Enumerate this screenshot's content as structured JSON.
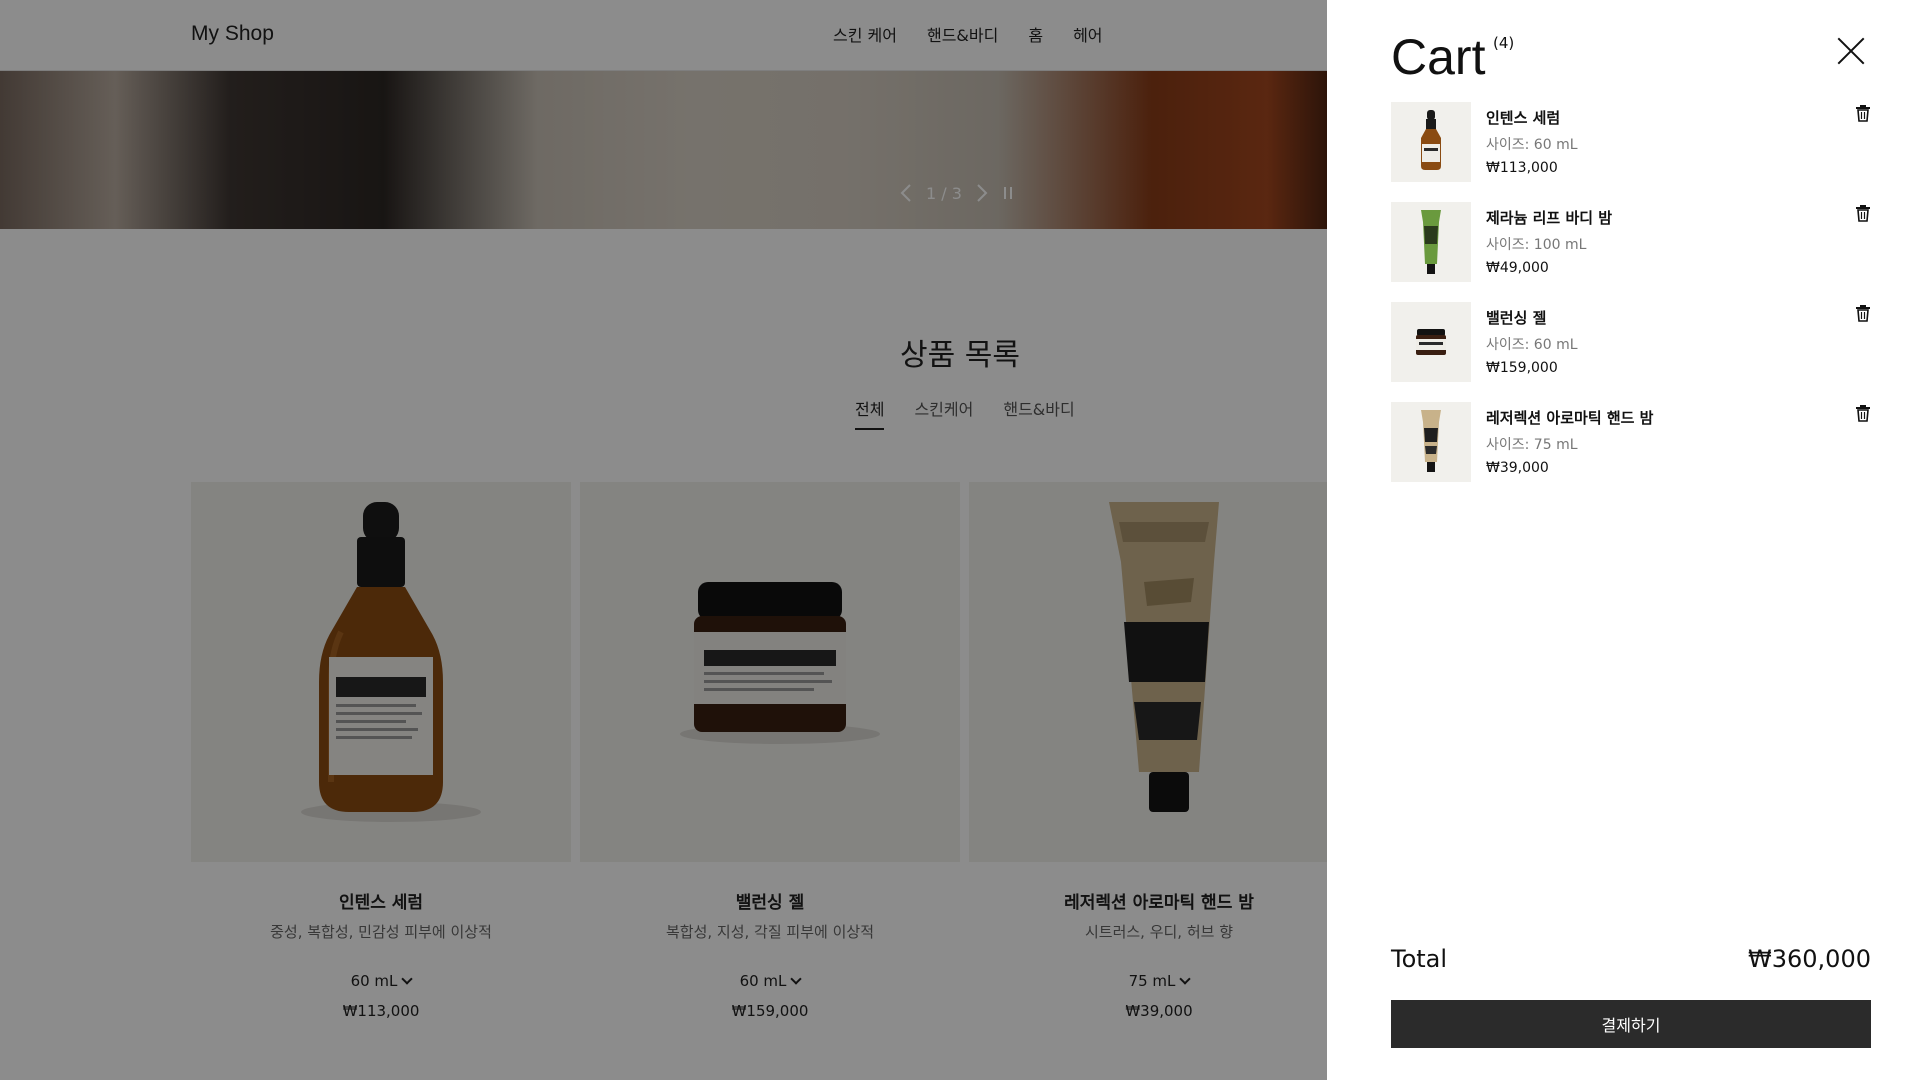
{
  "header": {
    "logo": "My Shop",
    "nav": [
      "스킨 케어",
      "핸드&바디",
      "홈",
      "헤어"
    ]
  },
  "hero": {
    "pager": "1 / 3"
  },
  "catalog": {
    "title": "상품 목록",
    "filters": [
      "전체",
      "스킨케어",
      "핸드&바디"
    ],
    "active_filter": "전체",
    "products": [
      {
        "name": "인텐스 세럼",
        "desc": "중성, 복합성, 민감성 피부에 이상적",
        "size": "60 mL",
        "price": "₩113,000"
      },
      {
        "name": "밸런싱 젤",
        "desc": "복합성, 지성, 각질 피부에 이상적",
        "size": "60 mL",
        "price": "₩159,000"
      },
      {
        "name": "레저렉션 아로마틱 핸드 밤",
        "desc": "시트러스, 우디, 허브 향",
        "size": "75 mL",
        "price": "₩39,000"
      }
    ]
  },
  "cart": {
    "title": "Cart",
    "count": "(4)",
    "items": [
      {
        "name": "인텐스 세럼",
        "size": "사이즈: 60 mL",
        "price": "₩113,000"
      },
      {
        "name": "제라늄 리프 바디 밤",
        "size": "사이즈: 100 mL",
        "price": "₩49,000"
      },
      {
        "name": "밸런싱 젤",
        "size": "사이즈: 60 mL",
        "price": "₩159,000"
      },
      {
        "name": "레저렉션 아로마틱 핸드 밤",
        "size": "사이즈: 75 mL",
        "price": "₩39,000"
      }
    ],
    "total_label": "Total",
    "total_value": "₩360,000",
    "checkout_label": "결제하기"
  },
  "icons": {
    "close": "close-icon",
    "trash": "trash-icon",
    "prev": "chevron-left-icon",
    "next": "chevron-right-icon",
    "pause": "pause-icon",
    "dropdown": "chevron-down-icon"
  },
  "colors": {
    "checkout_bg": "#2b2b2b",
    "overlay": "rgba(0,0,0,0.45)"
  }
}
